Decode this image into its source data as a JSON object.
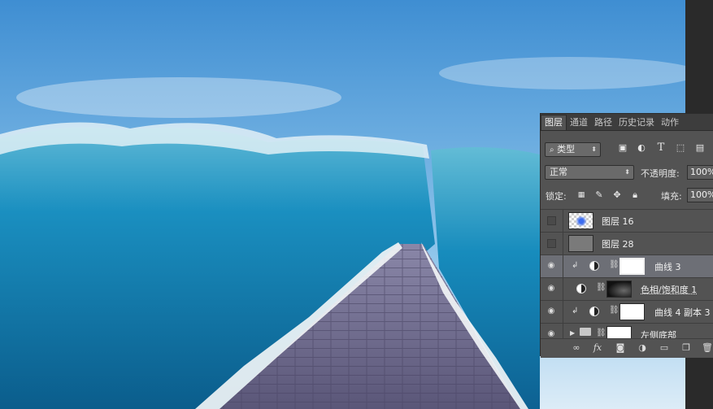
{
  "panel": {
    "tabs": [
      "图层",
      "通道",
      "路径",
      "历史记录",
      "动作"
    ],
    "filter": {
      "value": "类型"
    },
    "filter_icons": [
      "image-filter-icon",
      "adjustment-filter-icon",
      "text-filter-icon",
      "shape-filter-icon",
      "smart-object-filter-icon"
    ],
    "blend_mode": "正常",
    "opacity_label": "不透明度:",
    "opacity_value": "100%",
    "lock_label": "锁定:",
    "fill_label": "填充:",
    "fill_value": "100%",
    "layers": [
      {
        "name": "图层 16",
        "visible": false,
        "selected": false
      },
      {
        "name": "图层 28",
        "visible": false,
        "selected": false
      },
      {
        "name": "曲线 3",
        "visible": true,
        "selected": true
      },
      {
        "name": "色相/饱和度 1",
        "visible": true,
        "selected": false
      },
      {
        "name": "曲线 4 副本 3",
        "visible": true,
        "selected": false
      },
      {
        "name": "左侧底部",
        "visible": true,
        "selected": false
      }
    ]
  }
}
